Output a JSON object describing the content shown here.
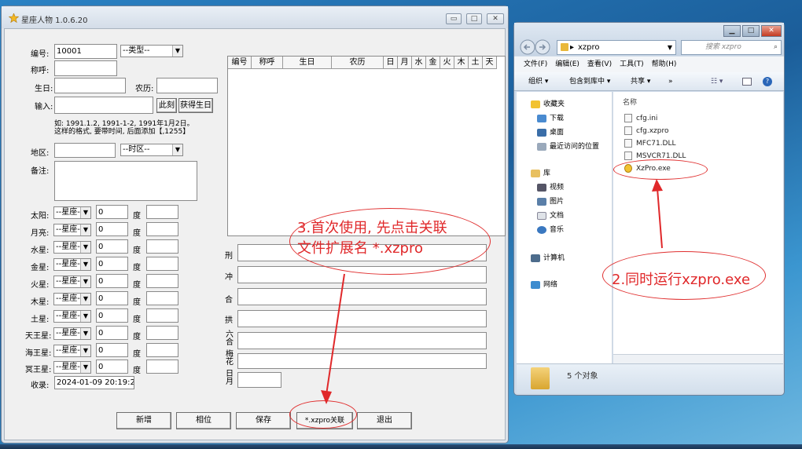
{
  "app": {
    "title": "星座人物 1.0.6.20",
    "title_buttons": [
      "▭",
      "□",
      "✕"
    ],
    "fields": {
      "code_label": "编号:",
      "code_value": "10001",
      "type_select": "--类型--",
      "name_label": "称呼:",
      "birth_label": "生日:",
      "lunar_label": "农历:",
      "input_label": "输入:",
      "now_button": "此刻",
      "get_birth_button": "获得生日",
      "hint_line1": "如: 1991.1.2, 1991-1-2, 1991年1月2日。",
      "hint_line2": "这样的格式, 要带时间, 后面添加【,1255】",
      "region_label": "地区:",
      "timezone_select": "--时区--",
      "notes_label": "备注:"
    },
    "planets": [
      {
        "label": "太阳:",
        "sign": "--星座--",
        "deg": "0",
        "unit": "度"
      },
      {
        "label": "月亮:",
        "sign": "--星座--",
        "deg": "0",
        "unit": "度"
      },
      {
        "label": "水星:",
        "sign": "--星座--",
        "deg": "0",
        "unit": "度"
      },
      {
        "label": "金星:",
        "sign": "--星座--",
        "deg": "0",
        "unit": "度"
      },
      {
        "label": "火星:",
        "sign": "--星座--",
        "deg": "0",
        "unit": "度"
      },
      {
        "label": "木星:",
        "sign": "--星座--",
        "deg": "0",
        "unit": "度"
      },
      {
        "label": "土星:",
        "sign": "--星座--",
        "deg": "0",
        "unit": "度"
      },
      {
        "label": "天王星:",
        "sign": "--星座--",
        "deg": "0",
        "unit": "度"
      },
      {
        "label": "海王星:",
        "sign": "--星座--",
        "deg": "0",
        "unit": "度"
      },
      {
        "label": "冥王星:",
        "sign": "--星座--",
        "deg": "0",
        "unit": "度"
      }
    ],
    "record_label": "收录:",
    "record_value": "2024-01-09 20:19:23",
    "grid_columns": [
      "编号",
      "称呼",
      "生日",
      "农历",
      "日",
      "月",
      "水",
      "金",
      "火",
      "木",
      "土",
      "天"
    ],
    "aspects": [
      {
        "label": "刑"
      },
      {
        "label": "冲"
      },
      {
        "label": "合"
      },
      {
        "label": "拱"
      },
      {
        "label": "六合"
      },
      {
        "label": "梅花"
      },
      {
        "label": "日月"
      }
    ],
    "buttons": {
      "add": "新增",
      "compare": "相位",
      "save": "保存",
      "associate": "*.xzpro关联",
      "exit": "退出"
    },
    "annotation_step3_line1": "3.首次使用, 先点击关联",
    "annotation_step3_line2": "文件扩展名 *.xzpro",
    "annotation_color": "#e0282a"
  },
  "explorer": {
    "address": "xzpro",
    "search_placeholder": "搜索 xzpro",
    "menu": [
      "文件(F)",
      "编辑(E)",
      "查看(V)",
      "工具(T)",
      "帮助(H)"
    ],
    "toolbar": [
      "组织 ▾",
      "包含到库中 ▾",
      "共享 ▾",
      "»"
    ],
    "nav": {
      "favorites": "收藏夹",
      "downloads": "下载",
      "desktop": "桌面",
      "recent": "最近访问的位置",
      "libraries": "库",
      "videos": "视频",
      "pictures": "图片",
      "documents": "文档",
      "music": "音乐",
      "computer": "计算机",
      "network": "网络"
    },
    "column_name": "名称",
    "files": [
      "cfg.ini",
      "cfg.xzpro",
      "MFC71.DLL",
      "MSVCR71.DLL",
      "XzPro.exe"
    ],
    "status": "5 个对象",
    "annotation_step2": "2.同时运行xzpro.exe"
  }
}
